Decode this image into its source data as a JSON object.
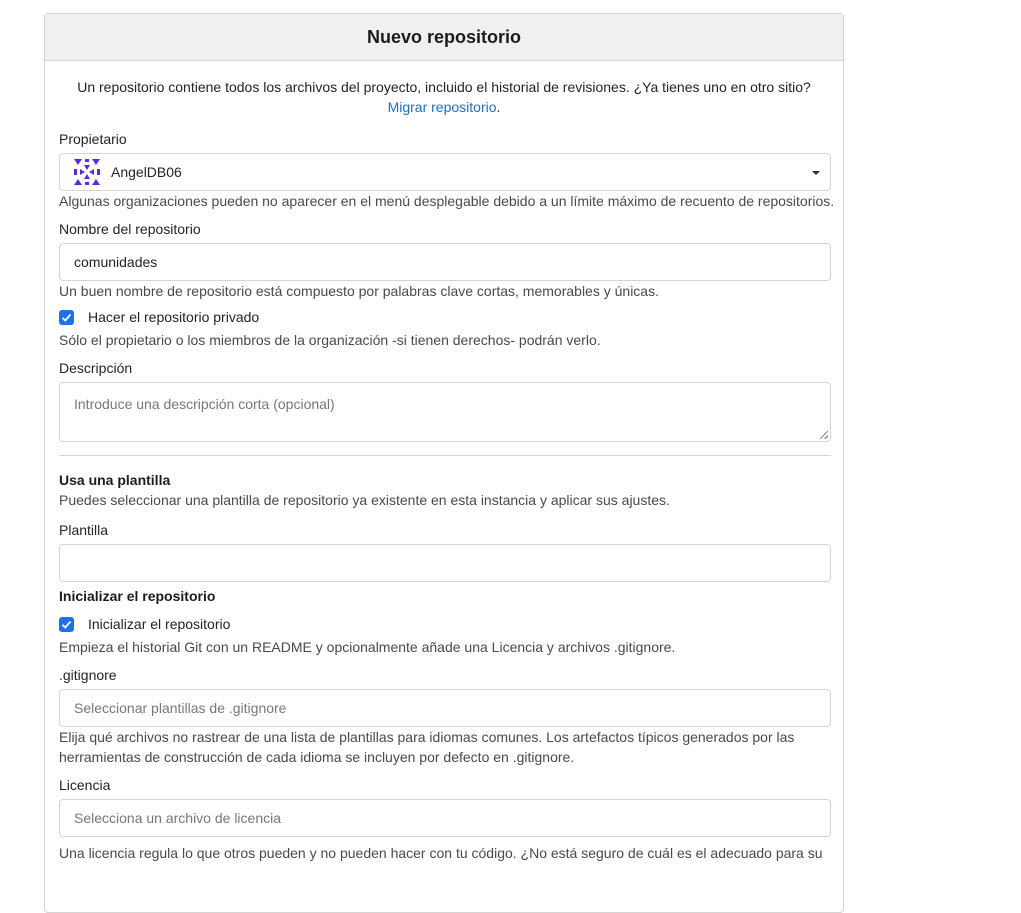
{
  "header": {
    "title": "Nuevo repositorio"
  },
  "intro": {
    "text": "Un repositorio contiene todos los archivos del proyecto, incluido el historial de revisiones. ¿Ya tienes uno en otro sitio?",
    "migrate_link": "Migrar repositorio",
    "suffix": "."
  },
  "owner": {
    "label": "Propietario",
    "value": "AngelDB06",
    "help": "Algunas organizaciones pueden no aparecer en el menú desplegable debido a un límite máximo de recuento de repositorios."
  },
  "repo_name": {
    "label": "Nombre del repositorio",
    "value": "comunidades",
    "help": "Un buen nombre de repositorio está compuesto por palabras clave cortas, memorables y únicas."
  },
  "private": {
    "label": "Hacer el repositorio privado",
    "checked": true,
    "help": "Sólo el propietario o los miembros de la organización -si tienen derechos- podrán verlo."
  },
  "description": {
    "label": "Descripción",
    "placeholder": "Introduce una descripción corta (opcional)"
  },
  "template": {
    "section_title": "Usa una plantilla",
    "section_help": "Puedes seleccionar una plantilla de repositorio ya existente en esta instancia y aplicar sus ajustes.",
    "label": "Plantilla",
    "value": ""
  },
  "init": {
    "section_title": "Inicializar el repositorio",
    "checkbox_label": "Inicializar el repositorio",
    "checked": true,
    "help": "Empieza el historial Git con un README y opcionalmente añade una Licencia y archivos .gitignore."
  },
  "gitignore": {
    "label": ".gitignore",
    "placeholder": "Seleccionar plantillas de .gitignore",
    "help": "Elija qué archivos no rastrear de una lista de plantillas para idiomas comunes. Los artefactos típicos generados por las herramientas de construcción de cada idioma se incluyen por defecto en .gitignore."
  },
  "license": {
    "label": "Licencia",
    "placeholder": "Selecciona un archivo de licencia",
    "help": "Una licencia regula lo que otros pueden y no pueden hacer con tu código. ¿No está seguro de cuál es el adecuado para su"
  },
  "colors": {
    "accent": "#1a73e8",
    "link": "#1e70bf",
    "avatar": "#5b2bd8"
  }
}
